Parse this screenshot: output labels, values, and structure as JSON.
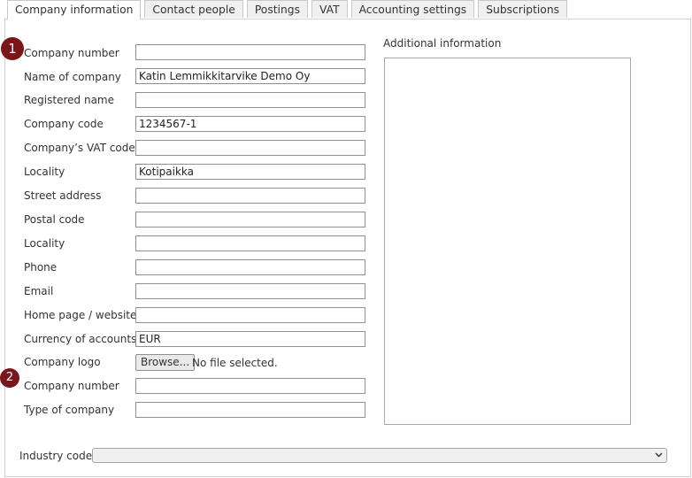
{
  "tabs": [
    {
      "label": "Company information",
      "active": true
    },
    {
      "label": "Contact people"
    },
    {
      "label": "Postings"
    },
    {
      "label": "VAT"
    },
    {
      "label": "Accounting settings"
    },
    {
      "label": "Subscriptions"
    }
  ],
  "badges": [
    "1",
    "2"
  ],
  "fields": [
    {
      "label": "Company number",
      "value": ""
    },
    {
      "label": "Name of company",
      "value": "Katin Lemmikkitarvike Demo Oy"
    },
    {
      "label": "Registered name",
      "value": ""
    },
    {
      "label": "Company code",
      "value": "1234567-1"
    },
    {
      "label": "Company’s VAT code",
      "value": ""
    },
    {
      "label": "Locality",
      "value": "Kotipaikka"
    },
    {
      "label": "Street address",
      "value": ""
    },
    {
      "label": "Postal code",
      "value": ""
    },
    {
      "label": "Locality",
      "value": ""
    },
    {
      "label": "Phone",
      "value": ""
    },
    {
      "label": "Email",
      "value": ""
    },
    {
      "label": "Home page / website",
      "value": ""
    },
    {
      "label": "Currency of accounts",
      "value": "EUR"
    }
  ],
  "logo": {
    "label": "Company logo",
    "browse_label": "Browse...",
    "status": "No file selected."
  },
  "fields_after": [
    {
      "label": "Company number",
      "value": ""
    },
    {
      "label": "Type of company",
      "value": ""
    }
  ],
  "additional_info": {
    "label": "Additional information",
    "value": ""
  },
  "industry": {
    "label": "Industry code",
    "value": "",
    "icon": "chevron-down-icon"
  },
  "colors": {
    "badge": "#7a1519",
    "tab_inactive": "#f0f0f0",
    "border": "#c9c9c9"
  }
}
